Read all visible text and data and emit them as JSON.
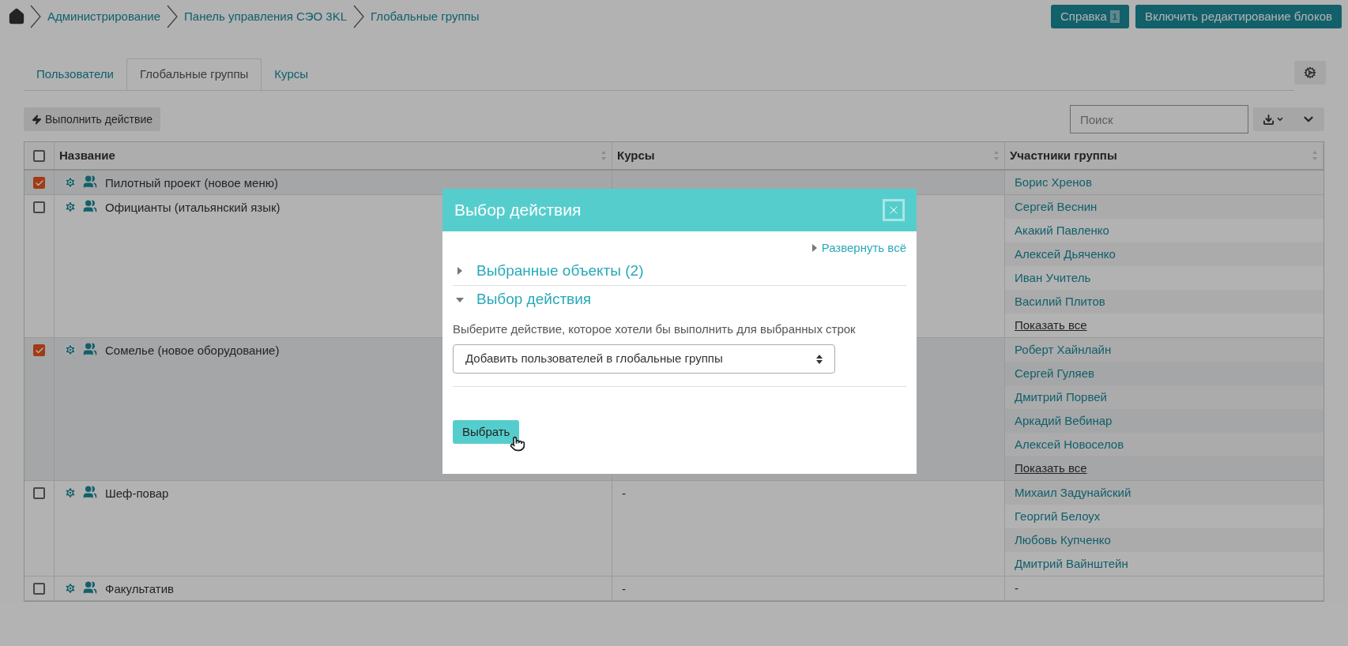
{
  "breadcrumb": [
    {
      "label": "Администрирование"
    },
    {
      "label": "Панель управления СЭО 3KL"
    },
    {
      "label": "Глобальные группы"
    }
  ],
  "header_buttons": {
    "help": {
      "label": "Справка",
      "badge": "1"
    },
    "edit": {
      "label": "Включить редактирование блоков"
    }
  },
  "tabs": [
    {
      "label": "Пользователи",
      "selected": false
    },
    {
      "label": "Глобальные группы",
      "selected": true
    },
    {
      "label": "Курсы",
      "selected": false
    }
  ],
  "action_button": {
    "label": "Выполнить действие"
  },
  "search": {
    "placeholder": "Поиск"
  },
  "table": {
    "columns": [
      "Название",
      "Курсы",
      "Участники группы"
    ],
    "all_checked": false,
    "rows": [
      {
        "checked": true,
        "name": "Пилотный проект (новое меню)",
        "members": [
          "Борис Хренов"
        ]
      },
      {
        "checked": false,
        "name": "Официанты (итальянский язык)",
        "members": [
          "Сергей Веснин",
          "Акакий Павленко",
          "Алексей Дьяченко",
          "Иван Учитель",
          "Василий Плитов"
        ],
        "show_all": "Показать все"
      },
      {
        "checked": true,
        "name": "Сомелье (новое оборудование)",
        "members": [
          "Роберт Хайнлайн",
          "Сергей Гуляев",
          "Дмитрий Порвей",
          "Аркадий Вебинар",
          "Алексей Новоселов"
        ],
        "show_all": "Показать все"
      },
      {
        "checked": false,
        "name": "Шеф-повар",
        "courses": "-",
        "members": [
          "Михаил Задунайский",
          "Георгий Белоух",
          "Любовь Купченко",
          "Дмитрий Вайнштейн"
        ]
      },
      {
        "checked": false,
        "name": "Факультатив",
        "courses": "-",
        "members_text": "-"
      }
    ]
  },
  "modal": {
    "title": "Выбор действия",
    "expand_all": "Развернуть всё",
    "sections": [
      {
        "title": "Выбранные объекты (2)",
        "expanded": false
      },
      {
        "title": "Выбор действия",
        "expanded": true
      }
    ],
    "prompt": "Выберите действие, которое хотели бы выполнить для выбранных строк",
    "select": {
      "value": "Добавить пользователей в глобальные группы"
    },
    "submit": {
      "label": "Выбрать"
    }
  }
}
